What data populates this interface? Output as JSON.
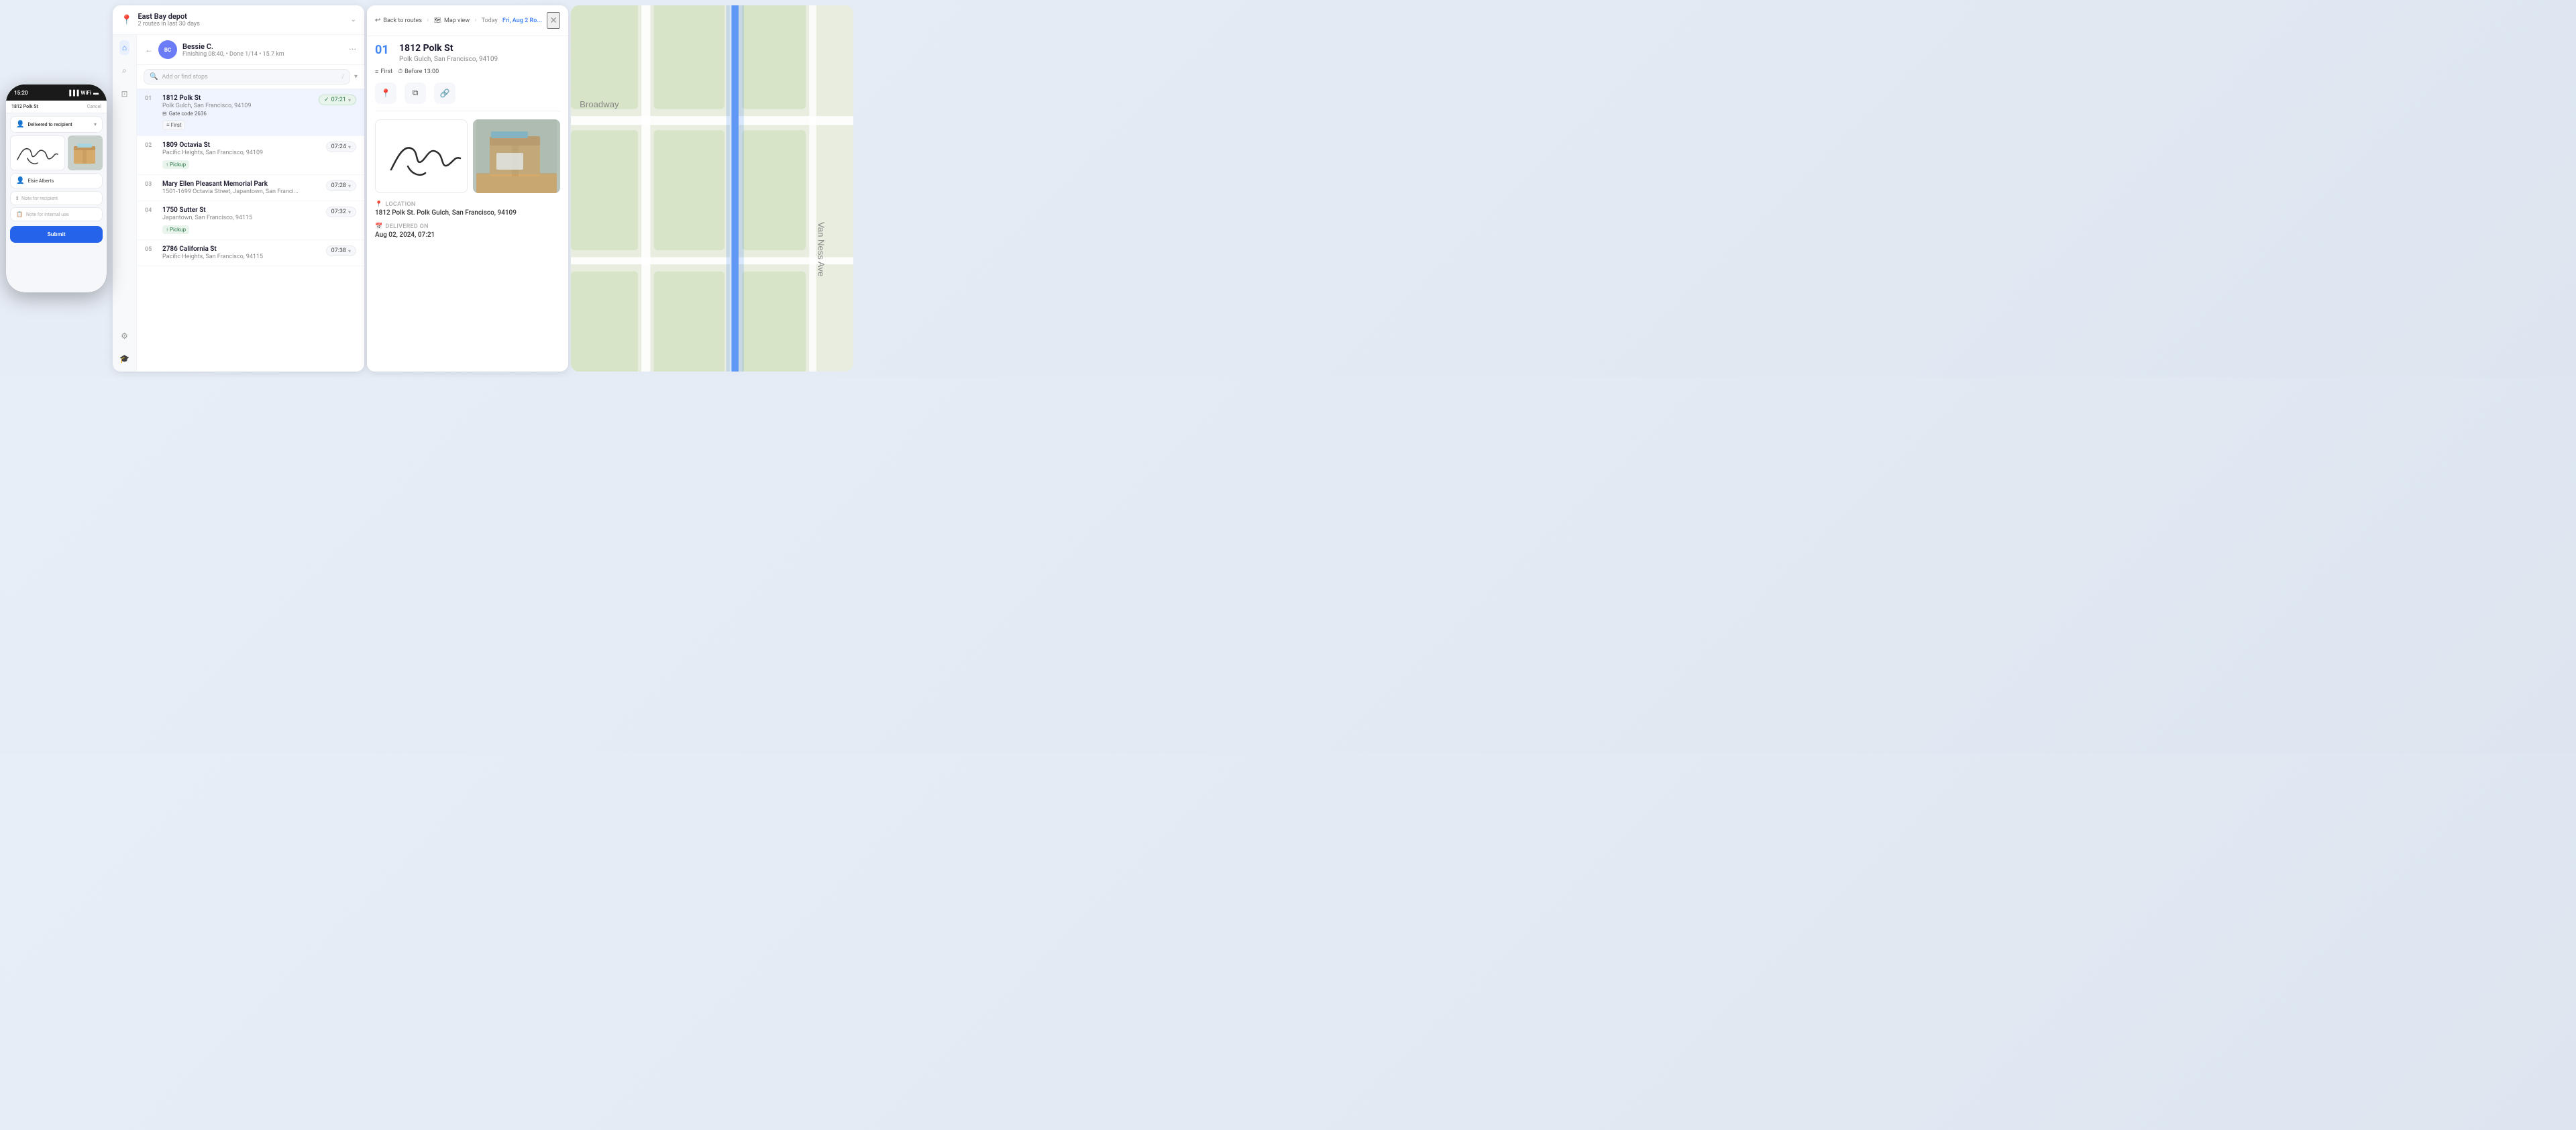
{
  "phone": {
    "time": "15:20",
    "address": "1812 Polk St",
    "cancel_label": "Cancel",
    "delivery_status": "Delivered to recipient",
    "recipient_name": "Elsie Alberts",
    "note_recipient_placeholder": "Note for recipient",
    "note_internal_placeholder": "Note for internal use",
    "submit_label": "Submit"
  },
  "depot": {
    "icon": "📍",
    "name": "East Bay depot",
    "sub": "2 routes in last 30 days"
  },
  "driver": {
    "initials": "BC",
    "name": "Bessie C.",
    "meta": "Finishing 08:40, • Done 1/14 • 15.7 km"
  },
  "search": {
    "placeholder": "Add or find stops",
    "slash_hint": "/"
  },
  "stops": [
    {
      "num": "01",
      "street": "1812 Polk St",
      "city": "Polk Gulch, San Francisco, 94109",
      "gate": "Gate code 2636",
      "badge": "First",
      "time": "07:21",
      "time_done": true
    },
    {
      "num": "02",
      "street": "1809 Octavia St",
      "city": "Pacific Heights, San Francisco, 94109",
      "pickup": "Pickup",
      "time": "07:24",
      "time_done": false
    },
    {
      "num": "03",
      "street": "Mary Ellen Pleasant Memorial Park",
      "city": "1501-1699 Octavia Street, Japantown, San Franci...",
      "time": "07:28",
      "time_done": false
    },
    {
      "num": "04",
      "street": "1750 Sutter St",
      "city": "Japantown, San Francisco, 94115",
      "pickup": "Pickup",
      "time": "07:32",
      "time_done": false
    },
    {
      "num": "05",
      "street": "2786 California St",
      "city": "Pacific Heights, San Francisco, 94115",
      "time": "07:38",
      "time_done": false
    }
  ],
  "detail": {
    "back_label": "Back to routes",
    "map_view_label": "Map view",
    "today_label": "Today",
    "date_label": "Fri, Aug 2 Ro...",
    "stop_num": "01",
    "street": "1812 Polk St",
    "address_sub": "Polk Gulch, San Francisco, 94109",
    "tag_first": "First",
    "tag_time": "Before 13:00",
    "location_label": "Location",
    "location_value": "1812 Polk St. Polk Gulch, San Francisco, 94109",
    "delivered_label": "Delivered on",
    "delivered_value": "Aug 02, 2024, 07:21"
  },
  "icons": {
    "home": "⌂",
    "search": "⌕",
    "monitor": "⊡",
    "gear": "⚙",
    "diploma": "🎓"
  }
}
